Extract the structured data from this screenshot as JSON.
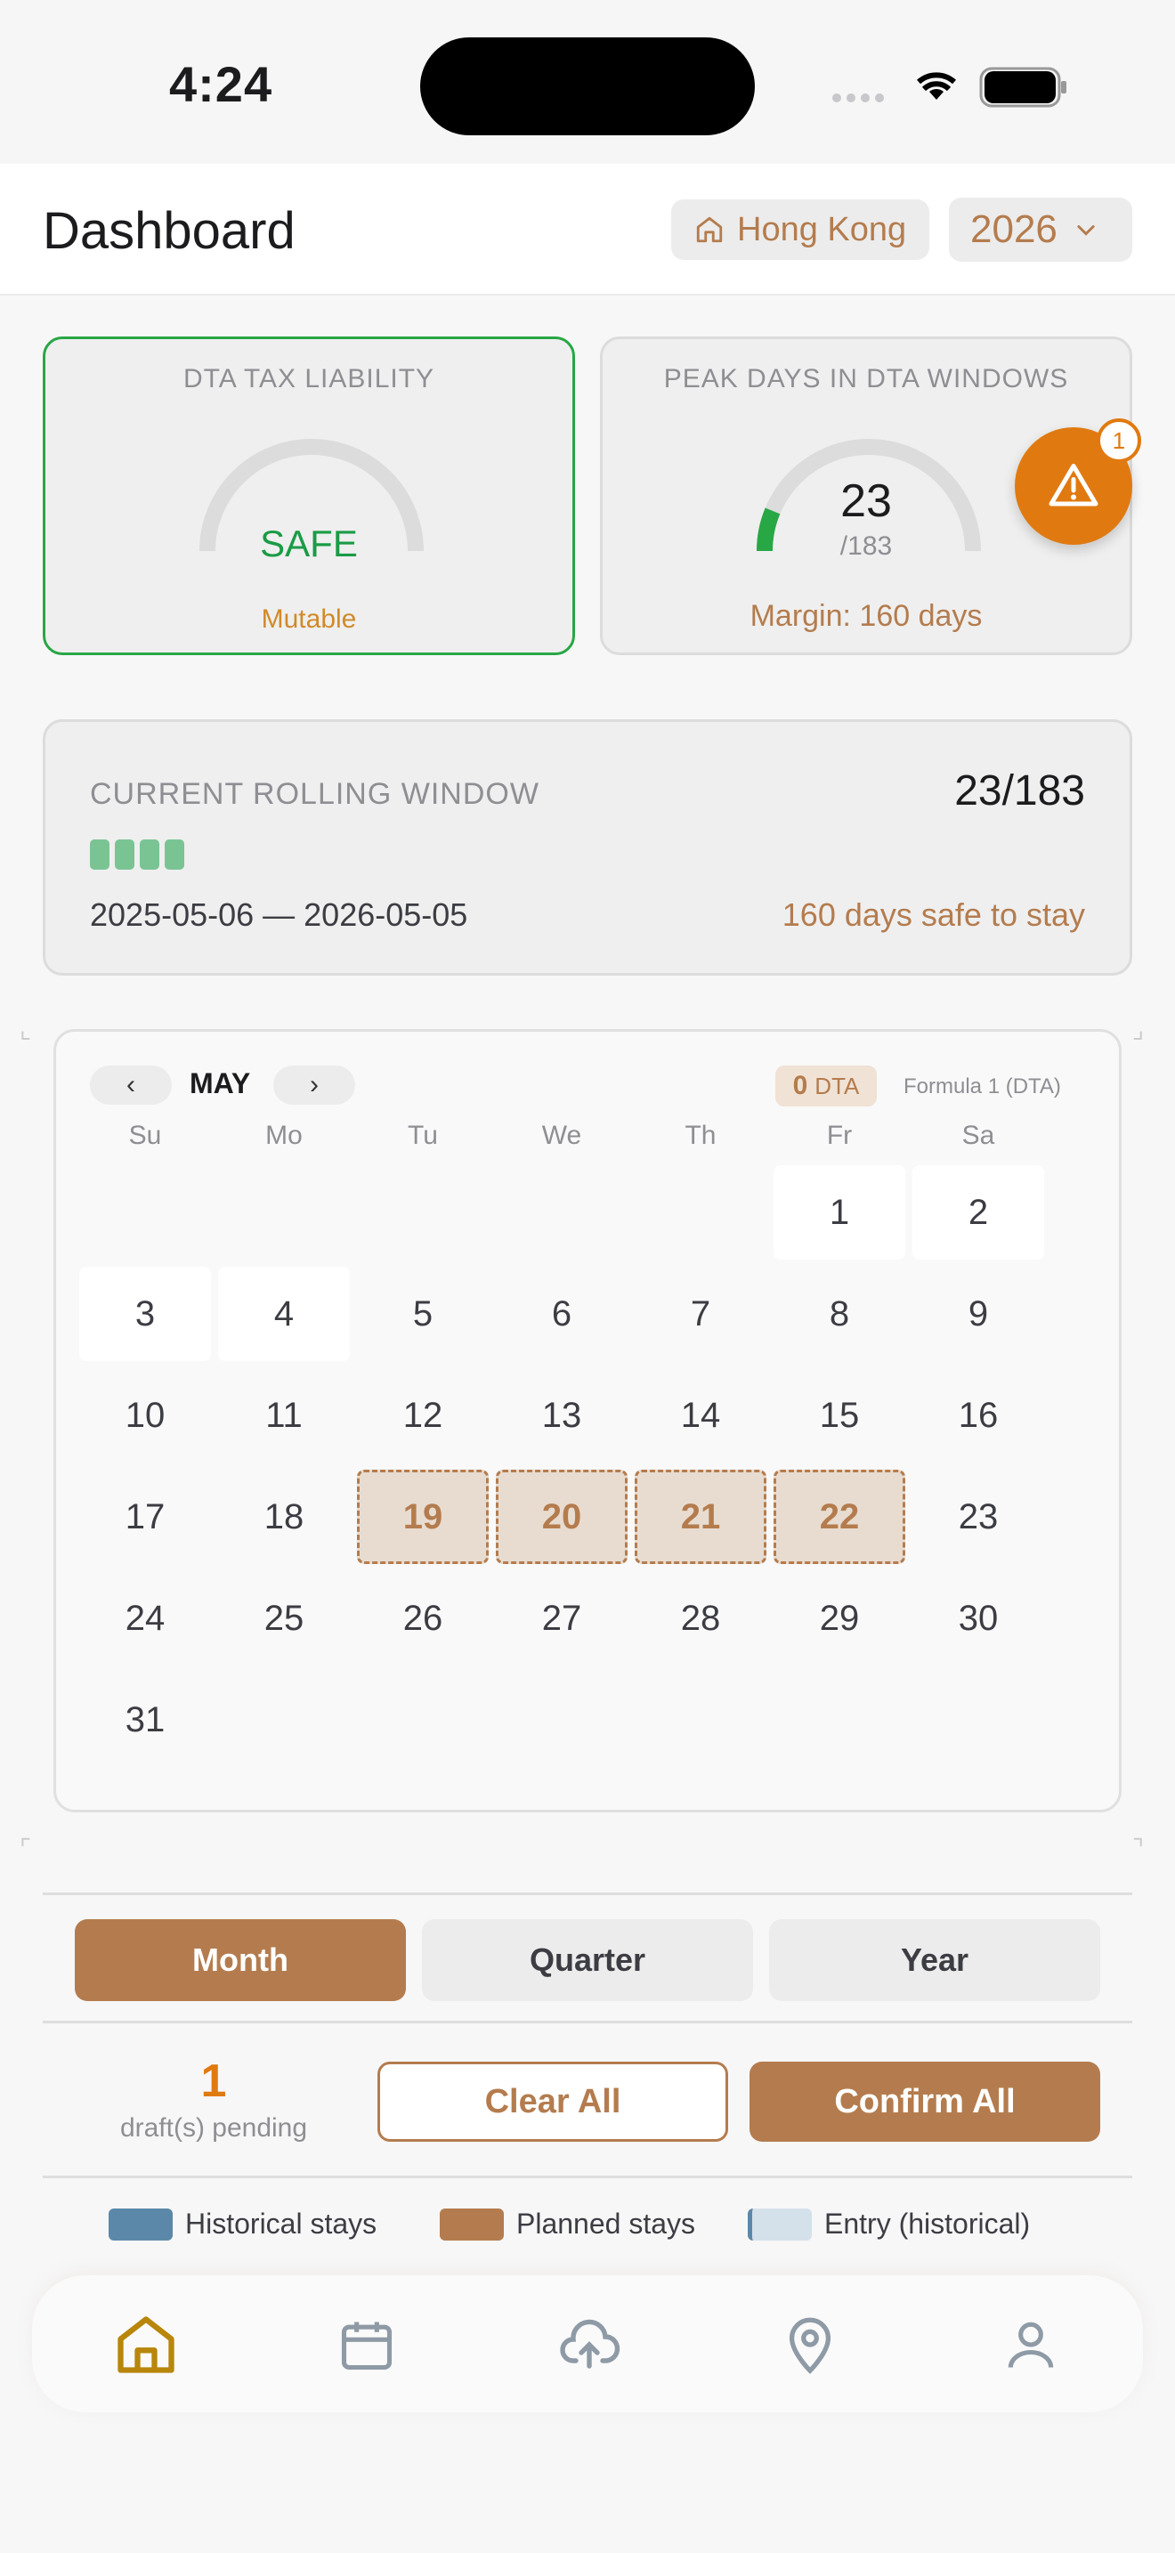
{
  "status_bar": {
    "time": "4:24"
  },
  "header": {
    "title": "Dashboard",
    "location": "Hong Kong",
    "year": "2026"
  },
  "cards": {
    "tax": {
      "label": "DTA TAX LIABILITY",
      "status": "SAFE",
      "note": "Mutable"
    },
    "peak": {
      "label": "PEAK DAYS IN DTA WINDOWS",
      "value": "23",
      "denominator": "/183",
      "margin": "Margin: 160 days",
      "progress": 0.126
    },
    "alert_badge": "1"
  },
  "rolling": {
    "label": "CURRENT ROLLING WINDOW",
    "count": "23/183",
    "dates": "2025-05-06 — 2026-05-05",
    "safe_text": "160 days safe to stay"
  },
  "calendar": {
    "prev": "‹",
    "next": "›",
    "month": "MAY",
    "dta_count": "0",
    "dta_label": "DTA",
    "formula": "Formula 1 (DTA)",
    "weekdays": [
      "Su",
      "Mo",
      "Tu",
      "We",
      "Th",
      "Fr",
      "Sa"
    ],
    "days": [
      "1",
      "2",
      "3",
      "4",
      "5",
      "6",
      "7",
      "8",
      "9",
      "10",
      "11",
      "12",
      "13",
      "14",
      "15",
      "16",
      "17",
      "18",
      "19",
      "20",
      "21",
      "22",
      "23",
      "24",
      "25",
      "26",
      "27",
      "28",
      "29",
      "30",
      "31"
    ]
  },
  "segments": {
    "month": "Month",
    "quarter": "Quarter",
    "year": "Year"
  },
  "drafts": {
    "count": "1",
    "label": "draft(s) pending",
    "clear": "Clear All",
    "confirm": "Confirm All"
  },
  "legend": {
    "historical": "Historical stays",
    "planned": "Planned stays",
    "entry": "Entry (historical)"
  },
  "colors": {
    "accent": "#b47c4e",
    "safe": "#28a745",
    "warning": "#e07a10",
    "historical": "#5b88a8",
    "entry": "#d4e1ea"
  },
  "tabbar": [
    "home-icon",
    "calendar-icon",
    "cloud-upload-icon",
    "map-pin-icon",
    "user-icon"
  ]
}
